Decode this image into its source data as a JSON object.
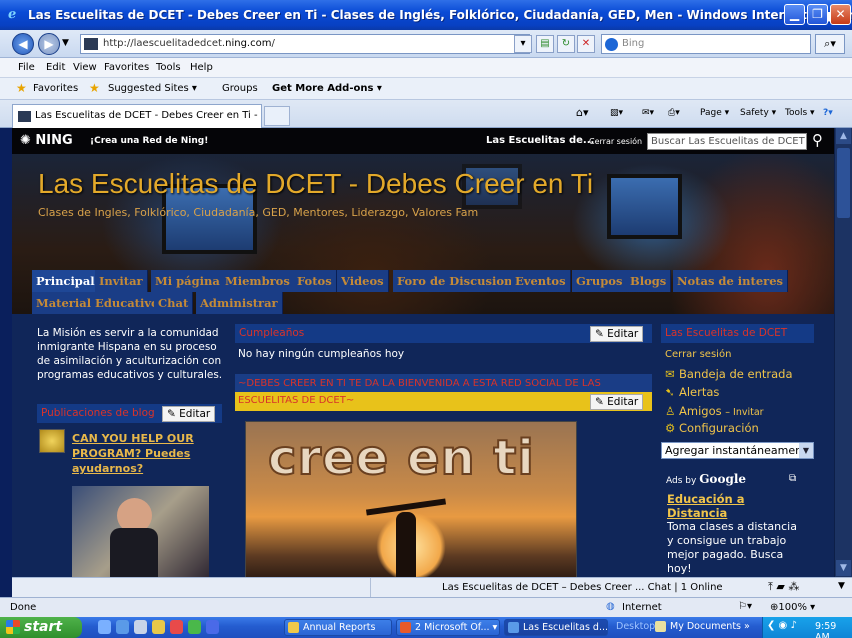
{
  "window": {
    "title": "Las Escuelitas de DCET - Debes Creer en Ti - Clases de Inglés, Folklórico, Ciudadanía, GED, Men - Windows Internet Explorer"
  },
  "address": {
    "url_prefix": "http://laescuelitadedcet.",
    "url_domain": "ning.com",
    "url_suffix": "/",
    "search_placeholder": "Bing"
  },
  "menu": [
    "File",
    "Edit",
    "View",
    "Favorites",
    "Tools",
    "Help"
  ],
  "favorites": {
    "favorites_label": "Favorites",
    "suggested": "Suggested Sites ▾",
    "groups": "Groups",
    "addons": "Get More Add-ons ▾"
  },
  "tab": {
    "title": "Las Escuelitas de DCET - Debes Creer en Ti - Clases d...",
    "commands": {
      "page": "Page ▾",
      "safety": "Safety ▾",
      "tools": "Tools ▾"
    }
  },
  "ning": {
    "logo": "NING",
    "create": "¡Crea una Red de Ning!",
    "site_short": "Las Escuelitas de...",
    "logout": "Cerrar sesión",
    "search_placeholder": "Buscar Las Escuelitas de DCET -"
  },
  "banner": {
    "title": "Las Escuelitas de DCET - Debes Creer en Ti",
    "tagline": "Clases de Ingles, Folklórico, Ciudadanía, GED, Mentores, Liderazgo, Valores Fam"
  },
  "nav": {
    "items": [
      "Principal",
      "Invitar",
      "Mi página",
      "Miembros",
      "Fotos",
      "Videos",
      "Foro de Discusion",
      "Eventos",
      "Grupos",
      "Blogs",
      "Notas de interes",
      "Material Educativo",
      "Chat",
      "Administrar"
    ]
  },
  "left": {
    "mission": "La Misión es servir a la comunidad inmigrante Hispana en su proceso de asimilación y aculturización con programas educativos y culturales.",
    "blog_heading": "Publicaciones de blog",
    "edit": "Editar",
    "blog_link": "CAN YOU HELP OUR PROGRAM? Puedes ayudarnos?"
  },
  "center": {
    "bday_heading": "Cumpleaños",
    "edit": "Editar",
    "bday_text": "No hay ningún cumpleaños hoy",
    "welcome_heading": "~DEBES CREER EN TI TE DA LA BIENVENIDA A ESTA RED SOCIAL DE LAS ESCUELITAS DE DCET~",
    "image_text": "cree en ti"
  },
  "right": {
    "heading": "Las Escuelitas de DCET",
    "logout": "Cerrar sesión",
    "inbox": "Bandeja de entrada",
    "alerts": "Alertas",
    "friends": "Amigos",
    "invite": "– Invitar",
    "settings": "Configuración",
    "add_select": "Agregar instantáneamen",
    "ads_by": "Ads by",
    "google": "Google",
    "ad_title": "Educación a Distancia",
    "ad_body": "Toma clases a distancia y consigue un trabajo mejor pagado. Busca hoy!"
  },
  "page_footer": {
    "status": "Las Escuelitas de DCET – Debes Creer ... Chat | 1 Online"
  },
  "statusbar": {
    "left": "Done",
    "zone": "Internet",
    "zoom": "100%"
  },
  "taskbar": {
    "start": "start",
    "tasks": [
      "Annual Reports",
      "2 Microsoft Of...",
      "Las Escuelitas d..."
    ],
    "desktop": "Desktop",
    "my_documents": "My Documents",
    "time": "9:59 AM"
  },
  "colors": {
    "page_bg": "#102659",
    "nav_text": "#c48a38",
    "heading_red": "#d8332a",
    "accent_gold": "#f0c44a"
  }
}
